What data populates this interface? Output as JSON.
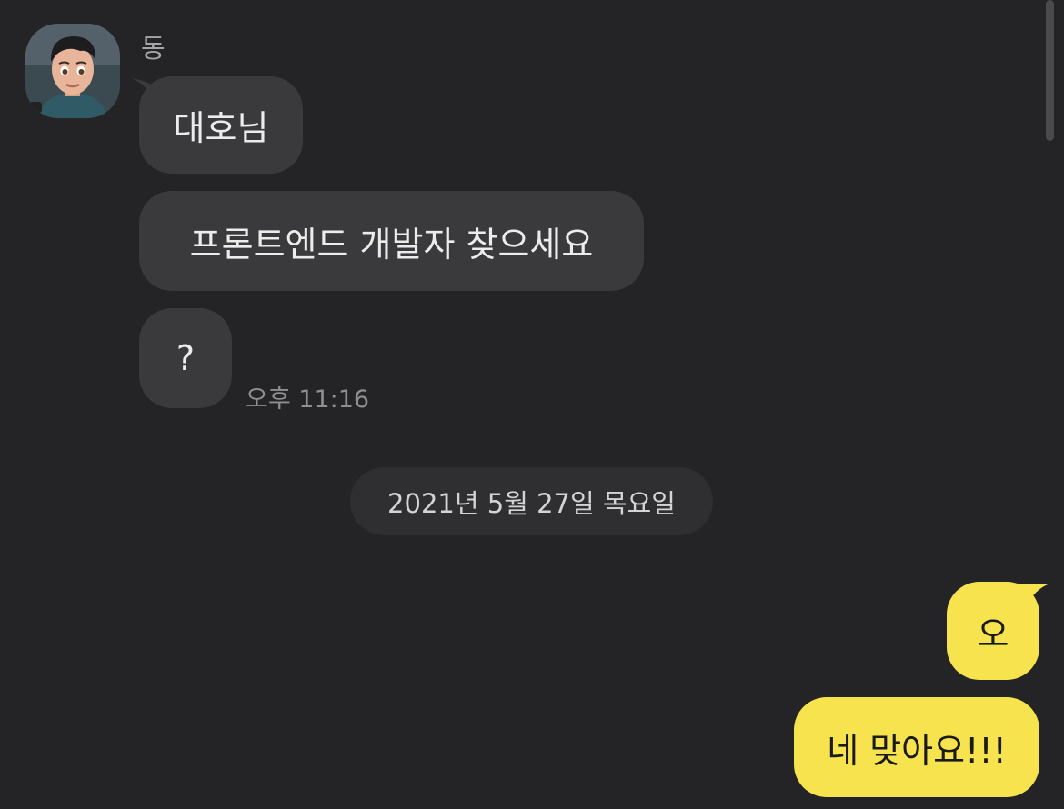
{
  "sender": {
    "name": "동",
    "avatar_icon": "profile-avatar-icon"
  },
  "incoming": {
    "messages": [
      "대호님",
      "프론트엔드 개발자 찾으세요",
      "?"
    ],
    "time": "오후 11:16"
  },
  "date_divider": "2021년 5월 27일 목요일",
  "outgoing": {
    "messages": [
      "오",
      "네 맞아요!!!"
    ]
  },
  "colors": {
    "background": "#242426",
    "incoming_bubble": "#3a3a3c",
    "outgoing_bubble": "#f7e34d",
    "date_pill": "#2f2f31"
  }
}
